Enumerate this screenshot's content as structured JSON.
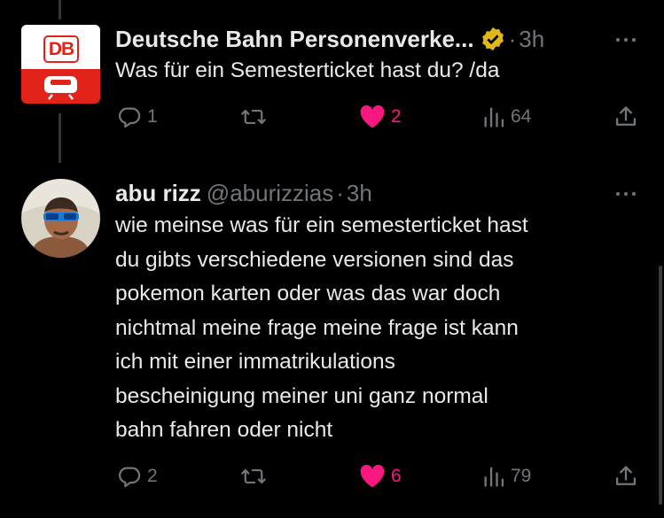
{
  "tweets": [
    {
      "author_name": "Deutsche Bahn Personenverke...",
      "verified": true,
      "time": "3h",
      "text": "Was für ein Semesterticket hast du? /da",
      "avatar_logo": "DB",
      "replies": "1",
      "likes": "2",
      "views": "64"
    },
    {
      "author_name": "abu rizz",
      "handle": "@aburizzias",
      "time": "3h",
      "text_lines": [
        "wie meinse was für ein semesterticket hast",
        "du gibts verschiedene versionen sind das",
        "pokemon karten oder was das war doch",
        "nichtmal meine frage meine frage ist kann",
        "ich mit einer immatrikulations",
        "bescheinigung meiner uni ganz normal",
        "bahn fahren oder nicht"
      ],
      "replies": "2",
      "likes": "6",
      "views": "79"
    }
  ],
  "separator": "·",
  "colors": {
    "background": "#000000",
    "text": "#e7e9ea",
    "muted": "#71767b",
    "like": "#f91880",
    "db_red": "#e2231a",
    "verified_gold": "#e2b719"
  },
  "icons": [
    "reply-icon",
    "retweet-icon",
    "heart-icon",
    "views-icon",
    "share-icon",
    "more-icon",
    "verified-badge-icon"
  ]
}
